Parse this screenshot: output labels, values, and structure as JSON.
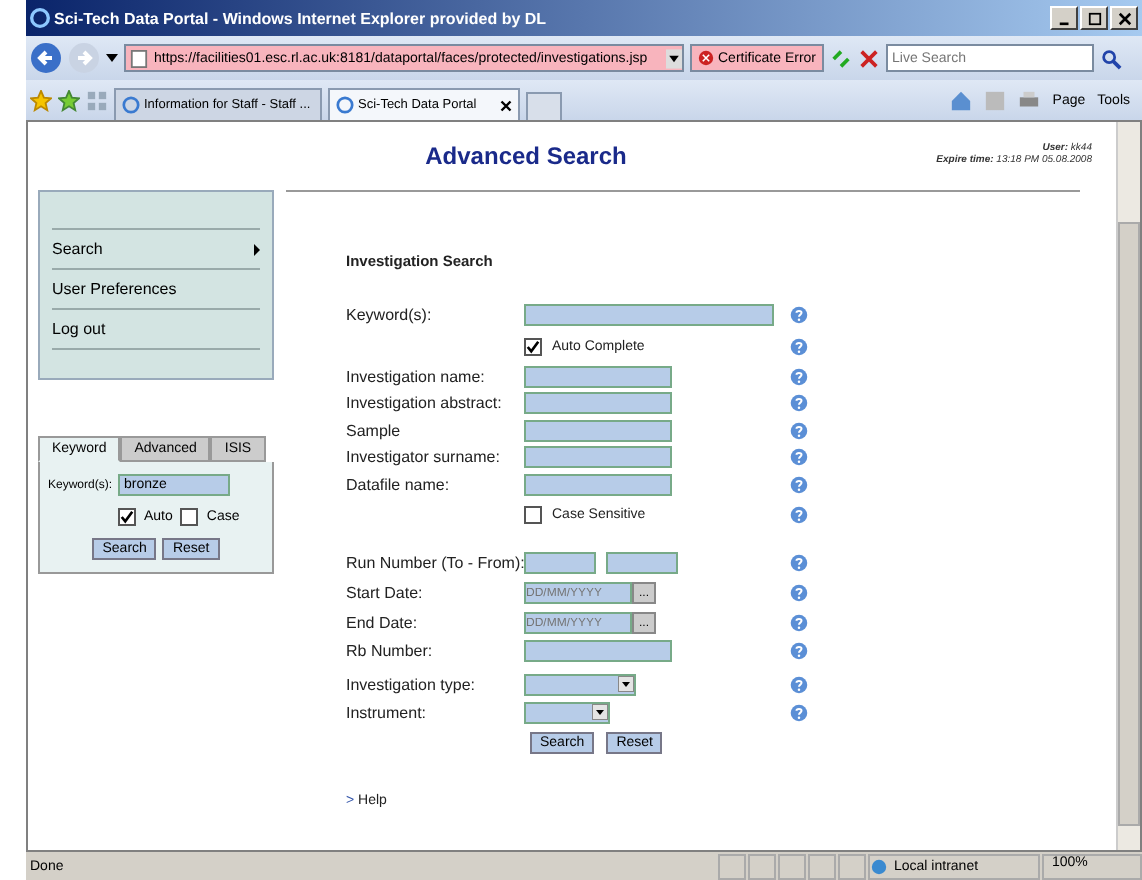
{
  "window": {
    "title": "Sci-Tech Data Portal - Windows Internet Explorer provided by DL"
  },
  "address_bar": {
    "url": "https://facilities01.esc.rl.ac.uk:8181/dataportal/faces/protected/investigations.jsp",
    "certificate": "Certificate Error",
    "search_placeholder": "Live Search"
  },
  "tabs": [
    {
      "label": "Information for Staff - Staff ...",
      "selected": false
    },
    {
      "label": "Sci-Tech Data Portal",
      "selected": true
    }
  ],
  "command_bar": [
    "Page",
    "Tools"
  ],
  "page": {
    "heading": "Advanced Search",
    "user_label": "User:",
    "user": "kk44",
    "expire_label": "Expire time:",
    "expire": "13:18 PM 05.08.2008"
  },
  "menu": [
    {
      "label": "Search",
      "submenu": true
    },
    {
      "label": "User Preferences",
      "submenu": false
    },
    {
      "label": "Log out",
      "submenu": false
    }
  ],
  "quick_search": {
    "tabs": [
      {
        "label": "Keyword",
        "selected": true
      },
      {
        "label": "Advanced",
        "selected": false
      },
      {
        "label": "ISIS",
        "selected": false
      }
    ],
    "label": "Keyword(s):",
    "value": "bronze",
    "options": [
      {
        "label": "Auto",
        "checked": true
      },
      {
        "label": "Case",
        "checked": false
      }
    ],
    "buttons": [
      "Search",
      "Reset"
    ]
  },
  "form": {
    "title": "Investigation Search",
    "rows": [
      {
        "kind": "wide",
        "label": "Keyword(s):"
      },
      {
        "kind": "checkbox",
        "label": "Auto Complete",
        "checked": true
      },
      {
        "kind": "text",
        "label": "Investigation name:"
      },
      {
        "kind": "text",
        "label": "Investigation abstract:"
      },
      {
        "kind": "text",
        "label": "Sample"
      },
      {
        "kind": "text",
        "label": "Investigator surname:"
      },
      {
        "kind": "text",
        "label": "Datafile name:"
      },
      {
        "kind": "checkbox",
        "label": "Case Sensitive",
        "checked": false
      },
      {
        "kind": "range",
        "label": "Run Number (To - From):"
      },
      {
        "kind": "date",
        "label": "Start Date:",
        "placeholder": "DD/MM/YYYY",
        "button": "..."
      },
      {
        "kind": "date",
        "label": "End Date:",
        "placeholder": "DD/MM/YYYY",
        "button": "..."
      },
      {
        "kind": "text",
        "label": "Rb Number:"
      },
      {
        "kind": "select",
        "label": "Investigation type:"
      },
      {
        "kind": "select",
        "label": "Instrument:"
      }
    ],
    "buttons": [
      "Search",
      "Reset"
    ],
    "help_marker": ">",
    "help": "Help"
  },
  "status_bar": {
    "text": "Done",
    "zone": "Local intranet",
    "zoom": "100%"
  }
}
